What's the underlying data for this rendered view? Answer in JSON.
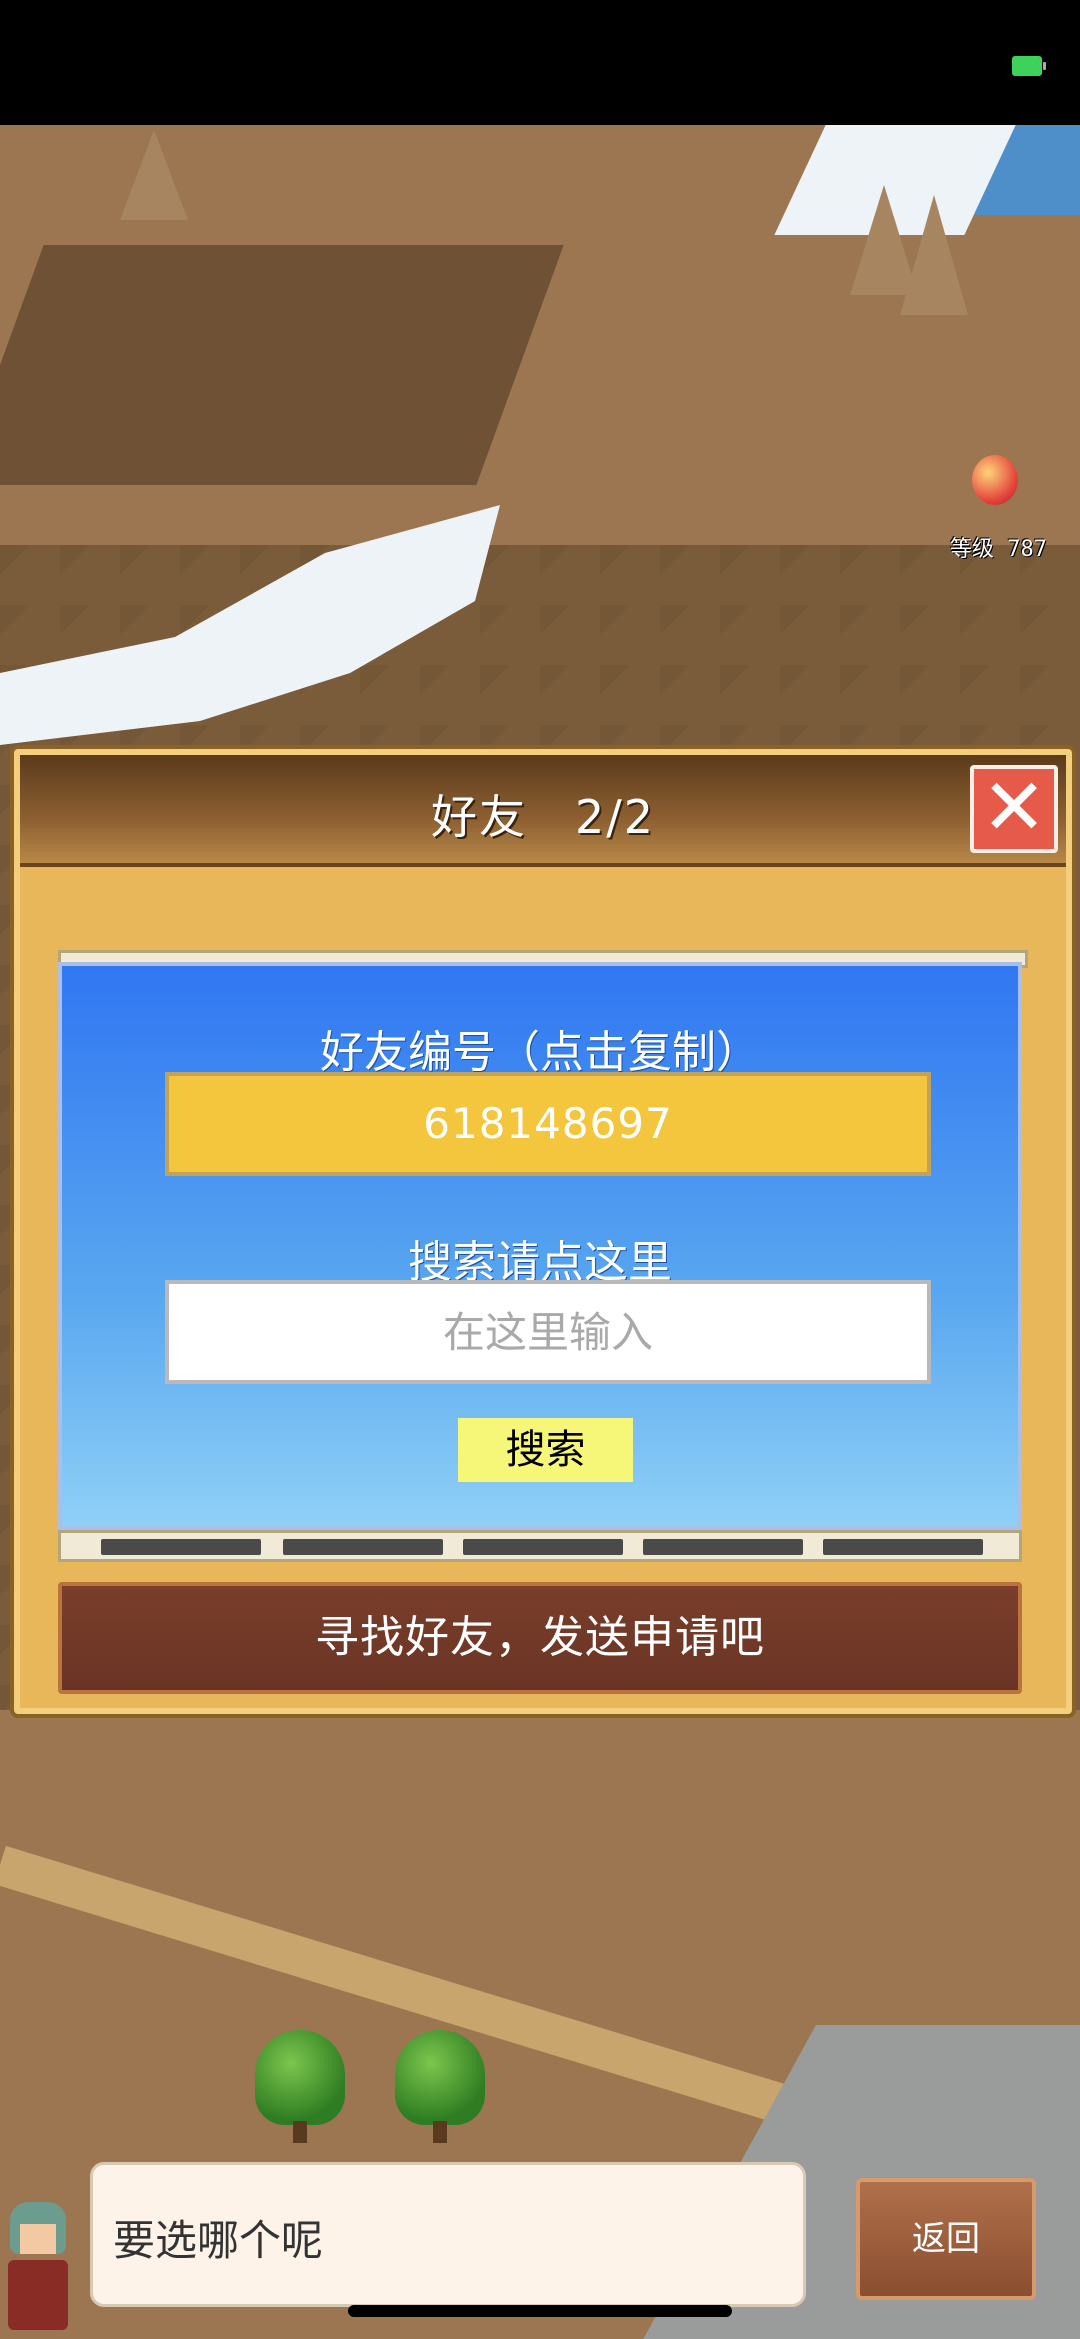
{
  "status": {
    "battery_icon": "battery-icon"
  },
  "map": {
    "level_label": "等级 787"
  },
  "dialog": {
    "title": "好友　2/2",
    "close_icon": "close-icon",
    "friend_code_label": "好友编号（点击复制）",
    "friend_code": "618148697",
    "search_label": "搜索请点这里",
    "search_placeholder": "在这里输入",
    "search_button": "搜索",
    "hint": "寻找好友，发送申请吧"
  },
  "bottom": {
    "speech": "要选哪个呢",
    "back_button": "返回"
  },
  "colors": {
    "panel_blue": "#3077f2",
    "code_yellow": "#f4c63d",
    "close_red": "#e65a4a",
    "hint_brown": "#7a3e2b"
  }
}
